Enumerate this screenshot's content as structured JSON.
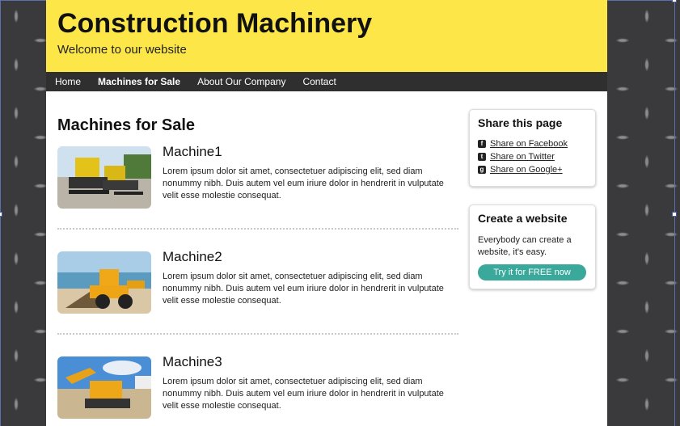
{
  "header": {
    "title": "Construction Machinery",
    "subtitle": "Welcome to our website"
  },
  "nav": {
    "items": [
      "Home",
      "Machines for Sale",
      "About Our Company",
      "Contact"
    ]
  },
  "main": {
    "heading": "Machines for Sale",
    "items": [
      {
        "title": "Machine1",
        "text": "Lorem ipsum dolor sit amet, consectetuer adipiscing elit, sed diam nonummy nibh. Duis autem vel eum iriure dolor in hendrerit in vulputate velit esse molestie consequat."
      },
      {
        "title": "Machine2",
        "text": "Lorem ipsum dolor sit amet, consectetuer adipiscing elit, sed diam nonummy nibh. Duis autem vel eum iriure dolor in hendrerit in vulputate velit esse molestie consequat."
      },
      {
        "title": "Machine3",
        "text": "Lorem ipsum dolor sit amet, consectetuer adipiscing elit, sed diam nonummy nibh. Duis autem vel eum iriure dolor in hendrerit in vulputate velit esse molestie consequat."
      }
    ]
  },
  "share": {
    "heading": "Share this page",
    "links": [
      {
        "label": "Share on Facebook",
        "icon": "facebook-icon"
      },
      {
        "label": "Share on Twitter",
        "icon": "twitter-icon"
      },
      {
        "label": "Share on Google+",
        "icon": "googleplus-icon"
      }
    ]
  },
  "create": {
    "heading": "Create a website",
    "text": "Everybody can create a website, it's easy.",
    "button": "Try it for FREE now"
  },
  "colors": {
    "header_bg": "#fde748",
    "nav_bg": "#2f2f2f",
    "cta": "#3aa99b"
  }
}
